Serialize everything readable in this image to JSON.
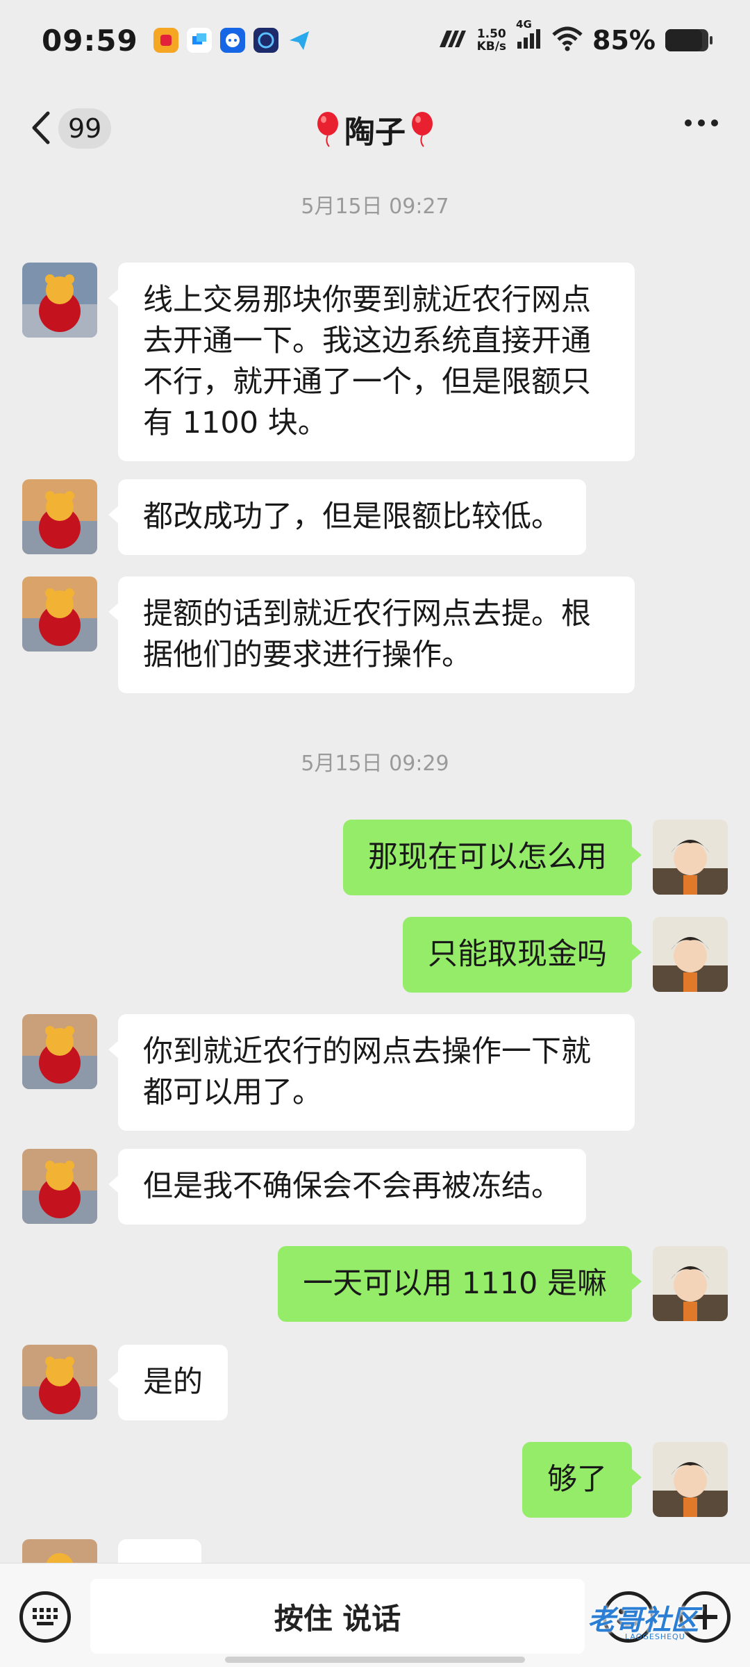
{
  "status_bar": {
    "time": "09:59",
    "net_speed_value": "1.50",
    "net_speed_unit": "KB/s",
    "network": "4G",
    "battery_text": "85%",
    "battery_level": 0.85
  },
  "nav": {
    "unread_count": "99",
    "contact_name": "陶子"
  },
  "messages": [
    {
      "type": "time",
      "text": "5月15日 09:27"
    },
    {
      "side": "left",
      "text": "线上交易那块你要到就近农行网点去开通一下。我这边系统直接开通不行，就开通了一个，但是限额只有 1100 块。"
    },
    {
      "side": "left",
      "text": "都改成功了，但是限额比较低。"
    },
    {
      "side": "left",
      "text": "提额的话到就近农行网点去提。根据他们的要求进行操作。"
    },
    {
      "type": "time",
      "text": "5月15日 09:29"
    },
    {
      "side": "right",
      "text": "那现在可以怎么用"
    },
    {
      "side": "right",
      "text": "只能取现金吗"
    },
    {
      "side": "left",
      "text": "你到就近农行的网点去操作一下就都可以用了。"
    },
    {
      "side": "left",
      "text": "但是我不确保会不会再被冻结。"
    },
    {
      "side": "right",
      "text": "一天可以用 1110 是嘛"
    },
    {
      "side": "left",
      "text": "是的"
    },
    {
      "side": "right",
      "text": "够了"
    }
  ],
  "input_bar": {
    "hold_to_talk": "按住 说话"
  },
  "watermark": {
    "text": "老哥社区",
    "sub": "LAOGESHEQU"
  },
  "colors": {
    "background": "#ededed",
    "bubble_self": "#95ec69",
    "bubble_other": "#ffffff"
  }
}
